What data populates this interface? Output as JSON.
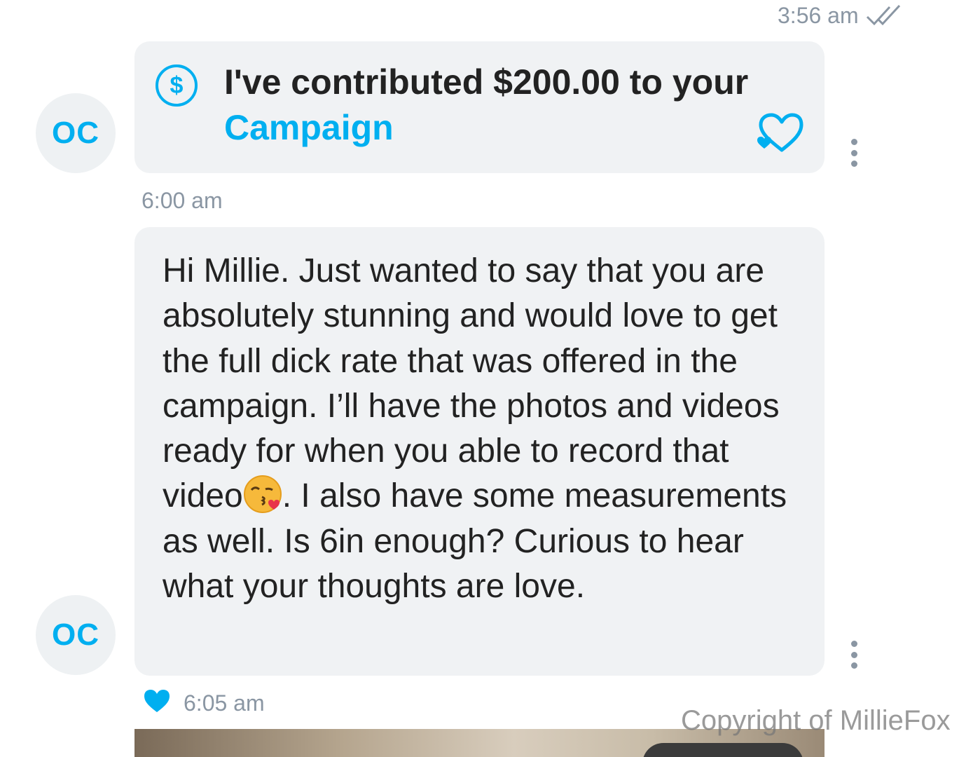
{
  "chat": {
    "top_time": "3:56 am",
    "messages": [
      {
        "avatar": "OC",
        "tip_text": "I've contributed $200.00 to your",
        "tip_link": "Campaign",
        "tip_icon": "dollar-circle-icon",
        "like_icon": "heart-outline-icon"
      },
      {
        "time_above": "6:00 am",
        "avatar": "OC",
        "text_before_emoji": "Hi Millie. Just wanted to say that you are absolutely stunning and would love to get the full dick rate that was offered in the campaign. I’ll have the photos and videos ready for when you able to record that video",
        "emoji": "face-blowing-kiss",
        "text_after_emoji": ". I also have some measurements as well. Is 6in enough? Curious to hear what your thoughts are love.",
        "liked": true,
        "time_below": "6:05 am"
      }
    ]
  },
  "watermark": "Copyright of MillieFox",
  "colors": {
    "accent": "#00aff0",
    "bubble_bg": "#f0f2f4",
    "muted_text": "#8a96a3"
  }
}
